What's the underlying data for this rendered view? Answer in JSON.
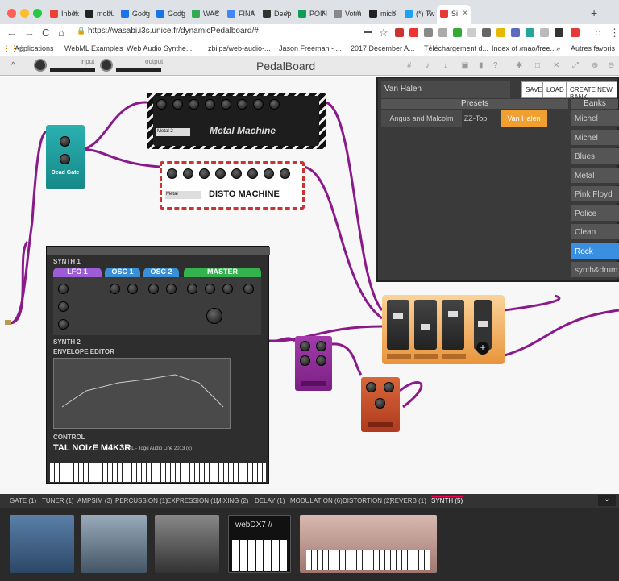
{
  "tabs": [
    {
      "label": "Inbox",
      "fav": "#ea4335"
    },
    {
      "label": "mobu",
      "fav": "#222"
    },
    {
      "label": "Goog",
      "fav": "#1a73e8"
    },
    {
      "label": "Goog",
      "fav": "#1a73e8"
    },
    {
      "label": "WAC",
      "fav": "#34a853"
    },
    {
      "label": "FINA",
      "fav": "#4285f4"
    },
    {
      "label": "Deep",
      "fav": "#333"
    },
    {
      "label": "POIN",
      "fav": "#0f9d58"
    },
    {
      "label": "Votm",
      "fav": "#888"
    },
    {
      "label": "micb",
      "fav": "#222"
    },
    {
      "label": "(*) Tw",
      "fav": "#1da1f2"
    },
    {
      "label": "Si",
      "fav": "#e53935"
    }
  ],
  "url": "https://wasabi.i3s.unice.fr/dynamicPedalboard/#",
  "bookmarks": [
    "Applications",
    "WebML Examples",
    "Web Audio Synthe...",
    "zbilps/web-audio-...",
    "Jason Freeman - ...",
    "2017 December A...",
    "Téléchargement d...",
    "Index of /mao/free...",
    "»",
    "Autres favoris"
  ],
  "app": {
    "title": "PedalBoard",
    "input_label": "input",
    "output_label": "output"
  },
  "bank_panel": {
    "bank_name": "Van Halen",
    "save": "SAVE",
    "load": "LOAD",
    "create": "CREATE NEW BANK",
    "presets_header": "Presets",
    "banks_header": "Banks",
    "presets": [
      "Angus and Malcolm",
      "ZZ-Top",
      "Van Halen"
    ],
    "banks": [
      "Michel",
      "Michel",
      "Blues",
      "Metal",
      "Pink Floyd",
      "Police",
      "Clean",
      "Rock",
      "synth&drum"
    ],
    "selected_bank": "Rock",
    "selected_preset": "Van Halen"
  },
  "pedals": {
    "noise_gate": "Dead Gate",
    "metal": "Metal Machine",
    "disto": "DISTO MACHINE",
    "synth_name": "TAL NOIzE M4K3R",
    "synth_sub": "TAL - Togu Audio Line 2013 (c)",
    "synth_sec1": "SYNTH 1",
    "synth_sec2": "SYNTH 2",
    "envelope": "ENVELOPE EDITOR",
    "control": "CONTROL",
    "lfo": "LFO 1",
    "osc1": "OSC 1",
    "osc2": "OSC 2",
    "master": "MASTER",
    "metal_preset": "Metal 2",
    "disto_preset": "Metal"
  },
  "categories": [
    "GATE (1)",
    "TUNER (1)",
    "AMPSIM (3)",
    "PERCUSSION (1)",
    "EXPRESSION (1)",
    "MIXING (2)",
    "DELAY (1)",
    "MODULATION (6)",
    "DISTORTION (2)",
    "REVERB (1)",
    "SYNTH (5)"
  ],
  "selected_category": "SYNTH (5)",
  "thumb_label": "webDX7 //"
}
